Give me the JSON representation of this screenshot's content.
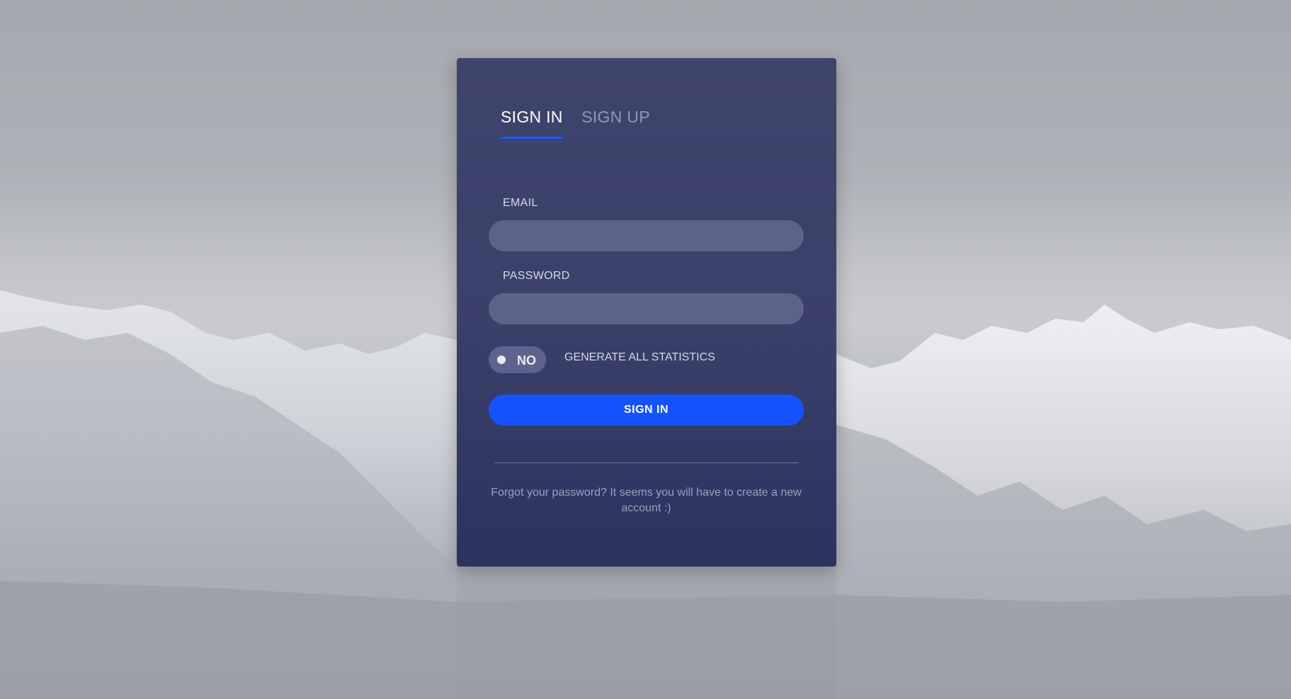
{
  "tabs": [
    {
      "label": "SIGN IN",
      "active": true
    },
    {
      "label": "SIGN UP",
      "active": false
    }
  ],
  "form": {
    "email_label": "EMAIL",
    "email_value": "",
    "password_label": "PASSWORD",
    "password_value": "",
    "toggle_state": "NO",
    "toggle_label": "GENERATE ALL STATISTICS",
    "submit_label": "SIGN IN"
  },
  "footer": {
    "text": "Forgot your password? It seems you will have to create a new account :)"
  },
  "colors": {
    "accent": "#1553ff",
    "card": "#363d68"
  }
}
